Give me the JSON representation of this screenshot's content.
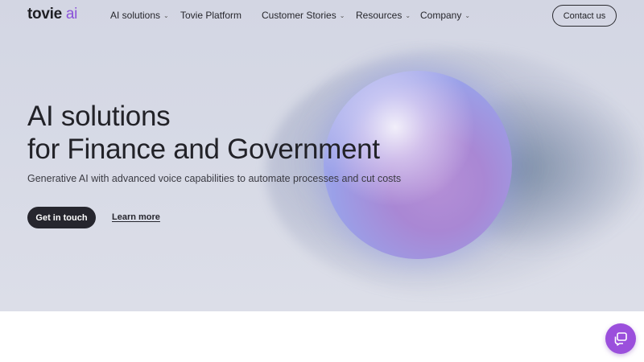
{
  "brand": {
    "name": "tovie",
    "accent": "ai",
    "accent_color": "#8b52d9"
  },
  "nav": {
    "items": [
      {
        "label": "AI solutions",
        "dropdown": true
      },
      {
        "label": "Tovie Platform",
        "dropdown": false
      },
      {
        "label": "Customer Stories",
        "dropdown": true
      },
      {
        "label": "Resources",
        "dropdown": true
      },
      {
        "label": "Company",
        "dropdown": true
      }
    ],
    "contact_label": "Contact us"
  },
  "hero": {
    "headline_line1": "AI solutions",
    "headline_line2": "for Finance and Government",
    "subheadline": "Generative AI with advanced voice capabilities to automate processes and cut costs",
    "primary_cta": "Get in touch",
    "secondary_cta": "Learn more",
    "background_color": "#d6d9e5"
  },
  "chat": {
    "icon": "chat-bubble-icon",
    "color": "#9b4fdc"
  }
}
